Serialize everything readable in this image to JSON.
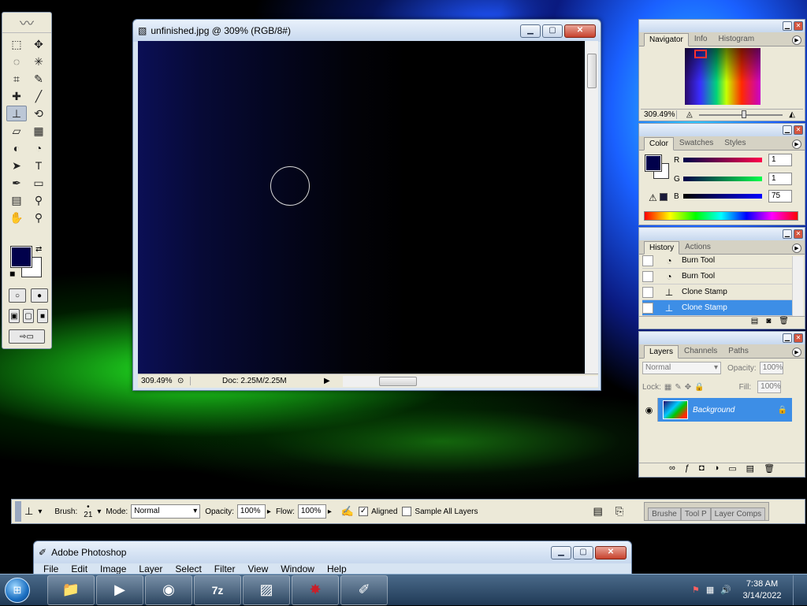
{
  "document": {
    "title": "unfinished.jpg @ 309% (RGB/8#)",
    "zoom": "309.49%",
    "doc_info": "Doc: 2.25M/2.25M"
  },
  "navigator": {
    "tabs": [
      "Navigator",
      "Info",
      "Histogram"
    ],
    "zoom": "309.49%"
  },
  "color": {
    "tabs": [
      "Color",
      "Swatches",
      "Styles"
    ],
    "r_label": "R",
    "g_label": "G",
    "b_label": "B",
    "r": "1",
    "g": "1",
    "b": "75",
    "foreground": "#01014b"
  },
  "history": {
    "tabs": [
      "History",
      "Actions"
    ],
    "items": [
      {
        "label": "Burn Tool",
        "icon": "burn-icon"
      },
      {
        "label": "Burn Tool",
        "icon": "burn-icon"
      },
      {
        "label": "Clone Stamp",
        "icon": "clone-stamp-icon"
      },
      {
        "label": "Clone Stamp",
        "icon": "clone-stamp-icon"
      }
    ]
  },
  "layers": {
    "tabs": [
      "Layers",
      "Channels",
      "Paths"
    ],
    "blend_mode": "Normal",
    "opacity_label": "Opacity:",
    "opacity": "100%",
    "lock_label": "Lock:",
    "fill_label": "Fill:",
    "fill": "100%",
    "layer_name": "Background"
  },
  "options": {
    "brush_label": "Brush:",
    "brush_size": "21",
    "mode_label": "Mode:",
    "mode": "Normal",
    "opacity_label": "Opacity:",
    "opacity": "100%",
    "flow_label": "Flow:",
    "flow": "100%",
    "aligned_label": "Aligned",
    "sample_label": "Sample All Layers",
    "wells": [
      "Brushe",
      "Tool P",
      "Layer Comps"
    ]
  },
  "ps_window": {
    "title": "Adobe Photoshop",
    "menu": [
      "File",
      "Edit",
      "Image",
      "Layer",
      "Select",
      "Filter",
      "View",
      "Window",
      "Help"
    ]
  },
  "taskbar": {
    "time": "7:38 AM",
    "date": "3/14/2022",
    "apps": [
      "explorer",
      "media-player",
      "chrome",
      "7zip",
      "image-viewer",
      "paint-app",
      "photoshop"
    ]
  },
  "colors": {
    "selection": "#3d8ee6",
    "foreground": "#01014b"
  }
}
